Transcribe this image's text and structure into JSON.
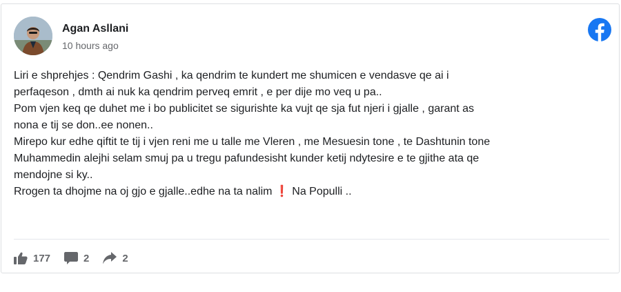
{
  "post": {
    "author": "Agan Asllani",
    "timestamp": "10 hours ago",
    "avatar_icon": "profile-photo",
    "brand_icon": "facebook-logo-icon",
    "brand_color": "#1877f2",
    "lines": [
      "Liri e shprehjes : Qendrim Gashi , ka qendrim te kundert me shumicen e vendasve qe ai i",
      "perfaqeson , dmth ai nuk ka qendrim perveq emrit , e per dije mo veq u pa..",
      "Pom vjen keq qe duhet me i bo publicitet se sigurishte ka vujt qe sja fut njeri i gjalle , garant as",
      "nona e tij se don..ee nonen..",
      "Mirepo kur edhe qiftit te tij i vjen reni me u talle me Vleren , me Mesuesin tone , te Dashtunin tone",
      "Muhammedin alejhi selam smuj pa u tregu pafundesisht kunder ketij ndytesire e te gjithe ata qe",
      "mendojne si ky..",
      "Rrogen ta dhojme na oj gjo e gjalle..edhe na ta nalim ❗ Na Populli .."
    ]
  },
  "footer": {
    "likes": "177",
    "comments": "2",
    "shares": "2",
    "icons": [
      "like-icon",
      "comment-icon",
      "share-icon"
    ],
    "icon_color": "#65676b"
  }
}
